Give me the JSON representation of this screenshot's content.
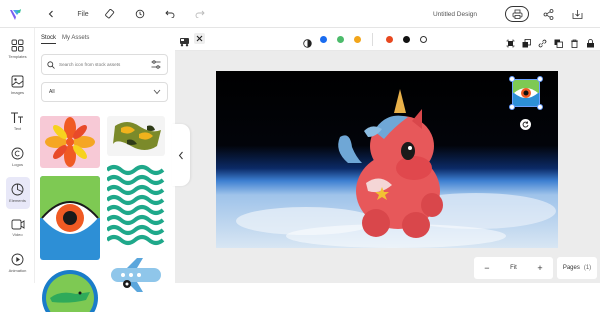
{
  "topbar": {
    "file_label": "File",
    "document_title": "Untitled Design"
  },
  "rail": {
    "items": [
      {
        "label": "Templates"
      },
      {
        "label": "Images"
      },
      {
        "label": "Text"
      },
      {
        "label": "Logos"
      },
      {
        "label": "Elements"
      },
      {
        "label": "Video"
      },
      {
        "label": "Animation"
      }
    ]
  },
  "panel": {
    "tabs": [
      {
        "label": "Stock"
      },
      {
        "label": "My Assets"
      }
    ],
    "search_placeholder": "Search icon from stock assets",
    "dropdown_value": "All"
  },
  "toolbar": {
    "colors": [
      "#1a6cf0",
      "#4cbb6b",
      "#f2a51a",
      "#e8481f",
      "#111111",
      "#ffffff"
    ]
  },
  "footer": {
    "zoom_label": "Fit",
    "pages_label": "Pages",
    "pages_count": "(1)"
  }
}
